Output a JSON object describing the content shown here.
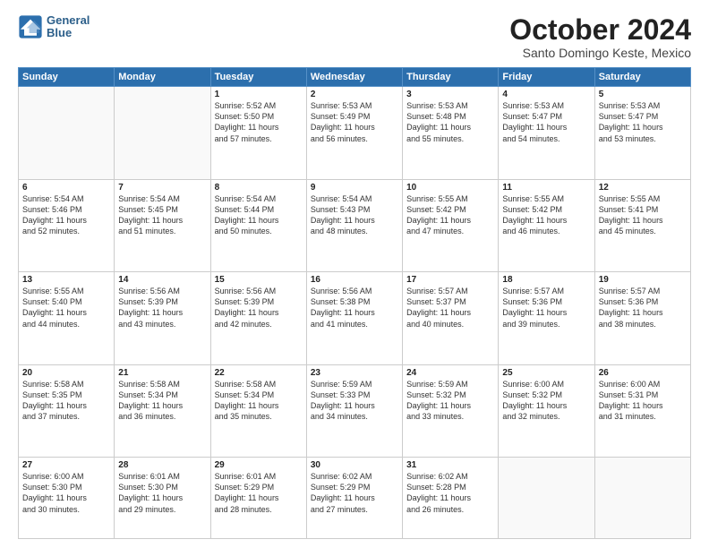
{
  "header": {
    "logo_line1": "General",
    "logo_line2": "Blue",
    "month": "October 2024",
    "location": "Santo Domingo Keste, Mexico"
  },
  "weekdays": [
    "Sunday",
    "Monday",
    "Tuesday",
    "Wednesday",
    "Thursday",
    "Friday",
    "Saturday"
  ],
  "weeks": [
    [
      {
        "day": "",
        "info": ""
      },
      {
        "day": "",
        "info": ""
      },
      {
        "day": "1",
        "info": "Sunrise: 5:52 AM\nSunset: 5:50 PM\nDaylight: 11 hours\nand 57 minutes."
      },
      {
        "day": "2",
        "info": "Sunrise: 5:53 AM\nSunset: 5:49 PM\nDaylight: 11 hours\nand 56 minutes."
      },
      {
        "day": "3",
        "info": "Sunrise: 5:53 AM\nSunset: 5:48 PM\nDaylight: 11 hours\nand 55 minutes."
      },
      {
        "day": "4",
        "info": "Sunrise: 5:53 AM\nSunset: 5:47 PM\nDaylight: 11 hours\nand 54 minutes."
      },
      {
        "day": "5",
        "info": "Sunrise: 5:53 AM\nSunset: 5:47 PM\nDaylight: 11 hours\nand 53 minutes."
      }
    ],
    [
      {
        "day": "6",
        "info": "Sunrise: 5:54 AM\nSunset: 5:46 PM\nDaylight: 11 hours\nand 52 minutes."
      },
      {
        "day": "7",
        "info": "Sunrise: 5:54 AM\nSunset: 5:45 PM\nDaylight: 11 hours\nand 51 minutes."
      },
      {
        "day": "8",
        "info": "Sunrise: 5:54 AM\nSunset: 5:44 PM\nDaylight: 11 hours\nand 50 minutes."
      },
      {
        "day": "9",
        "info": "Sunrise: 5:54 AM\nSunset: 5:43 PM\nDaylight: 11 hours\nand 48 minutes."
      },
      {
        "day": "10",
        "info": "Sunrise: 5:55 AM\nSunset: 5:42 PM\nDaylight: 11 hours\nand 47 minutes."
      },
      {
        "day": "11",
        "info": "Sunrise: 5:55 AM\nSunset: 5:42 PM\nDaylight: 11 hours\nand 46 minutes."
      },
      {
        "day": "12",
        "info": "Sunrise: 5:55 AM\nSunset: 5:41 PM\nDaylight: 11 hours\nand 45 minutes."
      }
    ],
    [
      {
        "day": "13",
        "info": "Sunrise: 5:55 AM\nSunset: 5:40 PM\nDaylight: 11 hours\nand 44 minutes."
      },
      {
        "day": "14",
        "info": "Sunrise: 5:56 AM\nSunset: 5:39 PM\nDaylight: 11 hours\nand 43 minutes."
      },
      {
        "day": "15",
        "info": "Sunrise: 5:56 AM\nSunset: 5:39 PM\nDaylight: 11 hours\nand 42 minutes."
      },
      {
        "day": "16",
        "info": "Sunrise: 5:56 AM\nSunset: 5:38 PM\nDaylight: 11 hours\nand 41 minutes."
      },
      {
        "day": "17",
        "info": "Sunrise: 5:57 AM\nSunset: 5:37 PM\nDaylight: 11 hours\nand 40 minutes."
      },
      {
        "day": "18",
        "info": "Sunrise: 5:57 AM\nSunset: 5:36 PM\nDaylight: 11 hours\nand 39 minutes."
      },
      {
        "day": "19",
        "info": "Sunrise: 5:57 AM\nSunset: 5:36 PM\nDaylight: 11 hours\nand 38 minutes."
      }
    ],
    [
      {
        "day": "20",
        "info": "Sunrise: 5:58 AM\nSunset: 5:35 PM\nDaylight: 11 hours\nand 37 minutes."
      },
      {
        "day": "21",
        "info": "Sunrise: 5:58 AM\nSunset: 5:34 PM\nDaylight: 11 hours\nand 36 minutes."
      },
      {
        "day": "22",
        "info": "Sunrise: 5:58 AM\nSunset: 5:34 PM\nDaylight: 11 hours\nand 35 minutes."
      },
      {
        "day": "23",
        "info": "Sunrise: 5:59 AM\nSunset: 5:33 PM\nDaylight: 11 hours\nand 34 minutes."
      },
      {
        "day": "24",
        "info": "Sunrise: 5:59 AM\nSunset: 5:32 PM\nDaylight: 11 hours\nand 33 minutes."
      },
      {
        "day": "25",
        "info": "Sunrise: 6:00 AM\nSunset: 5:32 PM\nDaylight: 11 hours\nand 32 minutes."
      },
      {
        "day": "26",
        "info": "Sunrise: 6:00 AM\nSunset: 5:31 PM\nDaylight: 11 hours\nand 31 minutes."
      }
    ],
    [
      {
        "day": "27",
        "info": "Sunrise: 6:00 AM\nSunset: 5:30 PM\nDaylight: 11 hours\nand 30 minutes."
      },
      {
        "day": "28",
        "info": "Sunrise: 6:01 AM\nSunset: 5:30 PM\nDaylight: 11 hours\nand 29 minutes."
      },
      {
        "day": "29",
        "info": "Sunrise: 6:01 AM\nSunset: 5:29 PM\nDaylight: 11 hours\nand 28 minutes."
      },
      {
        "day": "30",
        "info": "Sunrise: 6:02 AM\nSunset: 5:29 PM\nDaylight: 11 hours\nand 27 minutes."
      },
      {
        "day": "31",
        "info": "Sunrise: 6:02 AM\nSunset: 5:28 PM\nDaylight: 11 hours\nand 26 minutes."
      },
      {
        "day": "",
        "info": ""
      },
      {
        "day": "",
        "info": ""
      }
    ]
  ]
}
